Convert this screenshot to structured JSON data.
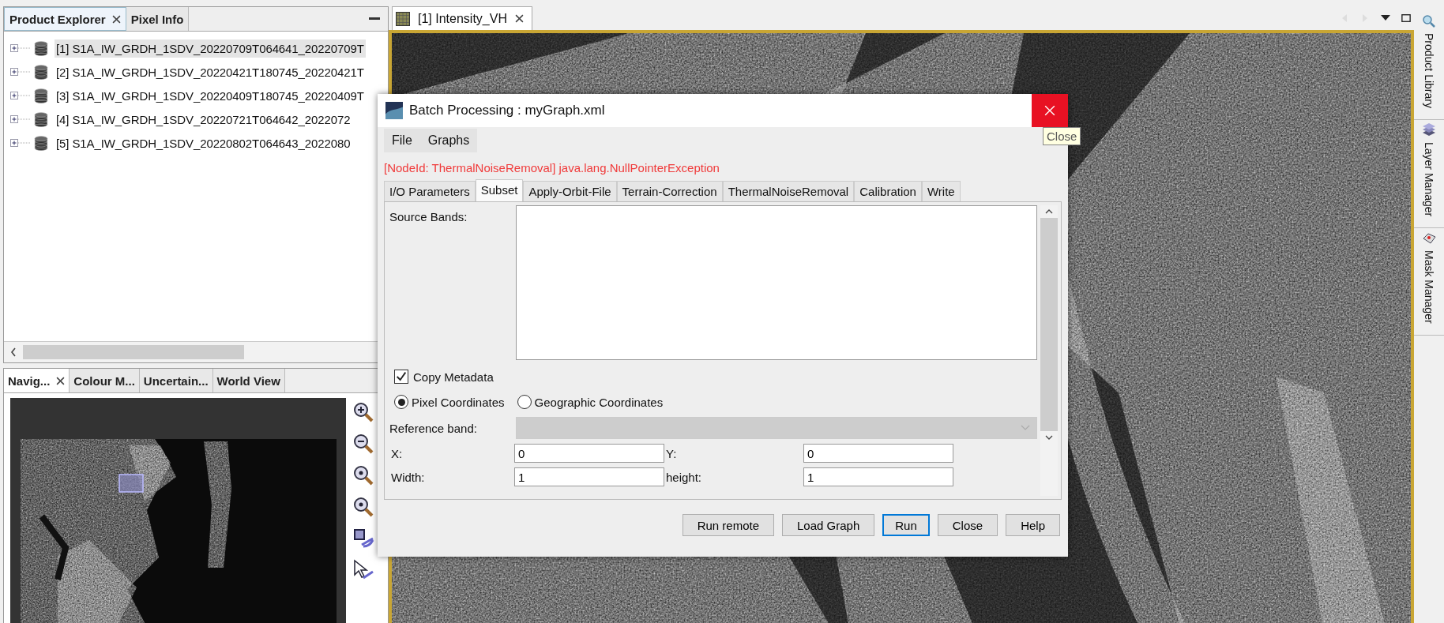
{
  "product_explorer": {
    "tabs": [
      {
        "label": "Product Explorer",
        "selected": true,
        "closable": true
      },
      {
        "label": "Pixel Info",
        "selected": false,
        "closable": false
      }
    ],
    "products": [
      {
        "label": "[1] S1A_IW_GRDH_1SDV_20220709T064641_20220709T",
        "selected": true
      },
      {
        "label": "[2] S1A_IW_GRDH_1SDV_20220421T180745_20220421T",
        "selected": false
      },
      {
        "label": "[3] S1A_IW_GRDH_1SDV_20220409T180745_20220409T",
        "selected": false
      },
      {
        "label": "[4] S1A_IW_GRDH_1SDV_20220721T064642_2022072",
        "selected": false
      },
      {
        "label": "[5] S1A_IW_GRDH_1SDV_20220802T064643_2022080",
        "selected": false
      }
    ]
  },
  "navigation_panel": {
    "tabs": [
      {
        "label": "Navig...",
        "selected": true,
        "closable": true
      },
      {
        "label": "Colour M...",
        "selected": false,
        "closable": false
      },
      {
        "label": "Uncertain...",
        "selected": false,
        "closable": false
      },
      {
        "label": "World View",
        "selected": false,
        "closable": false
      }
    ]
  },
  "image_view": {
    "tabs": [
      {
        "label": "[1] Intensity_VH",
        "selected": true
      }
    ]
  },
  "right_sidebar": {
    "items": [
      {
        "label": "Product Library",
        "kind": "library"
      },
      {
        "label": "Layer Manager",
        "kind": "layers"
      },
      {
        "label": "Mask Manager",
        "kind": "mask"
      }
    ]
  },
  "dialog": {
    "title": "Batch Processing : myGraph.xml",
    "close_tooltip": "Close",
    "menu": [
      "File",
      "Graphs"
    ],
    "error": "[NodeId: ThermalNoiseRemoval] java.lang.NullPointerException",
    "tabs": [
      {
        "label": "I/O Parameters",
        "selected": false
      },
      {
        "label": "Subset",
        "selected": true
      },
      {
        "label": "Apply-Orbit-File",
        "selected": false
      },
      {
        "label": "Terrain-Correction",
        "selected": false
      },
      {
        "label": "ThermalNoiseRemoval",
        "selected": false
      },
      {
        "label": "Calibration",
        "selected": false
      },
      {
        "label": "Write",
        "selected": false
      }
    ],
    "source_bands_label": "Source Bands:",
    "copy_metadata": {
      "label": "Copy Metadata",
      "checked": true
    },
    "coordinates": [
      {
        "label": "Pixel Coordinates",
        "selected": true
      },
      {
        "label": "Geographic Coordinates",
        "selected": false
      }
    ],
    "reference_band": {
      "label": "Reference band:",
      "disabled": true
    },
    "fields": [
      {
        "label": "X:",
        "value": "0"
      },
      {
        "label": "Y:",
        "value": "0"
      },
      {
        "label": "Width:",
        "value": "1"
      },
      {
        "label": "height:",
        "value": "1"
      }
    ],
    "buttons": [
      {
        "label": "Run remote",
        "focused": false
      },
      {
        "label": "Load Graph",
        "focused": false
      },
      {
        "label": "Run",
        "focused": true
      },
      {
        "label": "Close",
        "focused": false
      },
      {
        "label": "Help",
        "focused": false
      }
    ]
  }
}
